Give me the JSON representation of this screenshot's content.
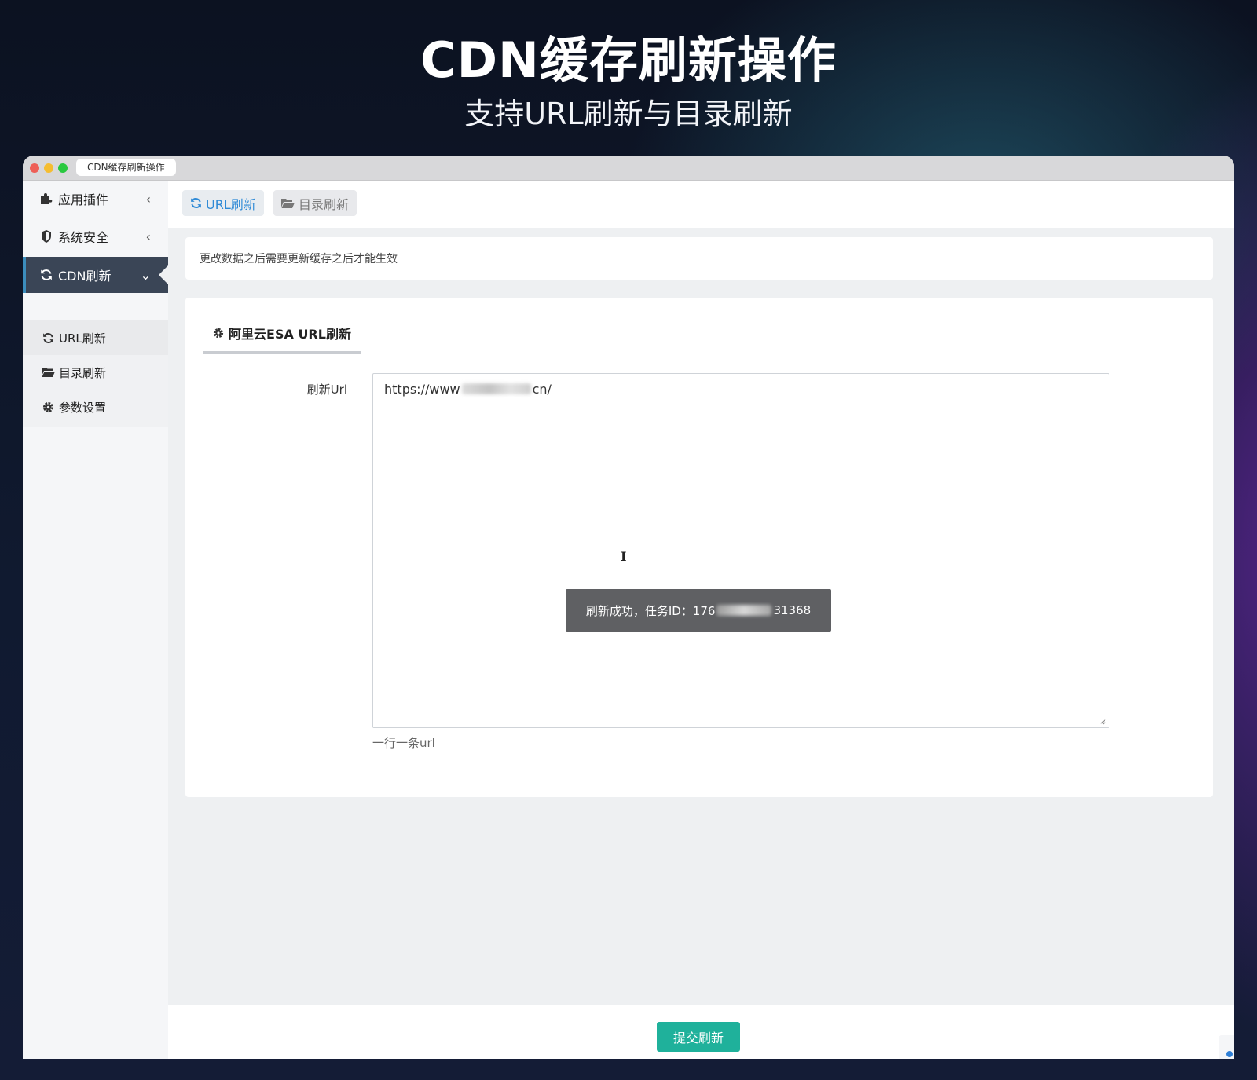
{
  "hero": {
    "title": "CDN缓存刷新操作",
    "subtitle": "支持URL刷新与目录刷新"
  },
  "window": {
    "tab_title": "CDN缓存刷新操作"
  },
  "sidebar": {
    "items": [
      {
        "label": "应用插件",
        "icon": "puzzle-icon",
        "arrow": "‹"
      },
      {
        "label": "系统安全",
        "icon": "shield-icon",
        "arrow": "‹"
      },
      {
        "label": "CDN刷新",
        "icon": "refresh-icon",
        "arrow": "⌄"
      }
    ],
    "submenu": [
      {
        "label": "URL刷新",
        "icon": "refresh-icon"
      },
      {
        "label": "目录刷新",
        "icon": "folder-open-icon"
      },
      {
        "label": "参数设置",
        "icon": "gear-icon"
      }
    ]
  },
  "topnav": {
    "url_refresh": "URL刷新",
    "dir_refresh": "目录刷新"
  },
  "notice": "更改数据之后需要更新缓存之后才能生效",
  "panel": {
    "tab_label": "阿里云ESA URL刷新",
    "field_label": "刷新Url",
    "url_prefix": "https://www",
    "url_suffix": "cn/",
    "help_text": "一行一条url",
    "toast_prefix": "刷新成功，任务ID：176",
    "toast_suffix": "31368"
  },
  "footer": {
    "submit_label": "提交刷新"
  },
  "colors": {
    "accent_blue": "#2f8ad6",
    "sidebar_active_bg": "#3a4556",
    "submit_green": "#1fb19b",
    "toast_bg": "#5f6063"
  }
}
